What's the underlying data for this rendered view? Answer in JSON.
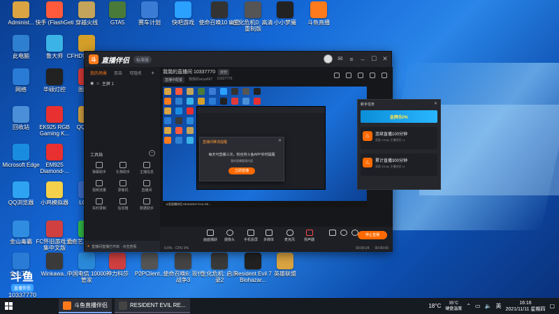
{
  "desktop_icons": [
    {
      "label": "Administ...",
      "color": "#d9a441"
    },
    {
      "label": "快手 (FlashGeti",
      "color": "#ff5a3c"
    },
    {
      "label": "穿越火线",
      "color": "#c4a35a"
    },
    {
      "label": "GTA5",
      "color": "#4a7a3a"
    },
    {
      "label": "赛车计划",
      "color": "#3a7bd5"
    },
    {
      "label": "快吧游戏",
      "color": "#2aa0ff"
    },
    {
      "label": "使命召唤10 幽灵",
      "color": "#333333"
    },
    {
      "label": "生化危机0: 高清重制版",
      "color": "#555555"
    },
    {
      "label": "小小梦魇",
      "color": "#222222"
    },
    {
      "label": "斗鱼直播",
      "color": "#ff7a1a"
    },
    {
      "label": "此电脑",
      "color": "#2f7fd0"
    },
    {
      "label": "鲁大师",
      "color": "#3bb3e6"
    },
    {
      "label": "CFHD官方 辅助",
      "color": "#d4a02a"
    },
    {
      "label": "网络",
      "color": "#2a7bd5"
    },
    {
      "label": "华硕灯控",
      "color": "#222222"
    },
    {
      "label": "图图卡",
      "color": "#e03a3a"
    },
    {
      "label": "回收站",
      "color": "#4b8fd9"
    },
    {
      "label": "EK925 RGB Gaming K...",
      "color": "#e83030"
    },
    {
      "label": "QQ三国",
      "color": "#d9a441"
    },
    {
      "label": "Microsoft Edge",
      "color": "#1a8ce0"
    },
    {
      "label": "EM925 Diamond-...",
      "color": "#e83030"
    },
    {
      "label": "QQ浏览器",
      "color": "#2ea3f2"
    },
    {
      "label": "小鸡模拟器",
      "color": "#f5d04a"
    },
    {
      "label": "LCore",
      "color": "#3a6fd0"
    },
    {
      "label": "金山毒霸",
      "color": "#2f8ce0"
    },
    {
      "label": "FC怀旧游戏 合集中文版",
      "color": "#d04040"
    },
    {
      "label": "爱奇艺万能 播放器",
      "color": "#33c04a"
    },
    {
      "label": "金山卫士",
      "color": "#2a7bd5"
    },
    {
      "label": "Winkawa...",
      "color": "#3a3a3a"
    },
    {
      "label": "中国电信 10000管家",
      "color": "#2a8ad9"
    },
    {
      "label": "神力科莎",
      "color": "#d04040"
    },
    {
      "label": "P2PClient...",
      "color": "#555555"
    },
    {
      "label": "使命召唤6: 现代战争3",
      "color": "#444444"
    },
    {
      "label": "生化危机: 启示录2",
      "color": "#3a3a3a"
    },
    {
      "label": "Resident Evil 7 Biohazar...",
      "color": "#222222"
    },
    {
      "label": "英雄联盟",
      "color": "#d9a441"
    }
  ],
  "app": {
    "name": "直播伴侣",
    "version": "标准版",
    "sidebar_tabs": [
      "我的场景",
      "双击",
      "可隐名"
    ],
    "scene_label": "主屏 1",
    "tools_title": "工具箱",
    "tools": [
      "弹幕助手",
      "礼物助手",
      "主播信息",
      "视频流量",
      "录像机",
      "直播间",
      "实时录制",
      "信息箱",
      "数据助手"
    ],
    "notice": "直播间直播已开启 · 点击查看",
    "room_title": "我我的直播间 10337770",
    "room_tag": "房管",
    "room_sub_tag": "直播中配置",
    "room_sub_text": "我我的anya667",
    "room_id_small": "10337770"
  },
  "preview": {
    "dialog_title": "直播间推流提醒",
    "dialog_text": "每天可直播三次，粉丝将斗鱼APP实时提醒",
    "dialog_sub": "我的直播管理内容",
    "dialog_button": "立即直播",
    "taskbar_text": "斗鱼直播伴侣  RESIDENT EVIL RE..."
  },
  "task_panel": {
    "title": "新手任务",
    "banner": "金牌乐PK",
    "tasks": [
      {
        "name": "连续直播100分钟",
        "reward": "奖励  100dp 主播经验 x1"
      },
      {
        "name": "累计直播300分钟",
        "reward": "奖励  300dp 主播经验 x1"
      }
    ]
  },
  "controls": [
    "画面捕获",
    "摄像头",
    "手机投屏",
    "多媒体",
    "麦克风",
    "扬声器"
  ],
  "start_button": "停止直播",
  "status": {
    "left": "0.0%  ·  CPU 0%",
    "duration": "00:00:24",
    "stat2": "00:00:00"
  },
  "taskbar": {
    "apps": [
      {
        "label": "斗鱼直播伴侣",
        "color": "#ff7a1a"
      },
      {
        "label": "RESIDENT EVIL RE...",
        "color": "#444444"
      }
    ],
    "weather_temp": "35°C",
    "weather_text": "硬盘温度",
    "outdoor_temp": "18°C",
    "ime": "英",
    "time": "16:16",
    "date": "2021/11/11 星期四"
  },
  "watermark": {
    "logo": "斗鱼",
    "pill": "直播伴侣",
    "room_id": "10337770"
  }
}
